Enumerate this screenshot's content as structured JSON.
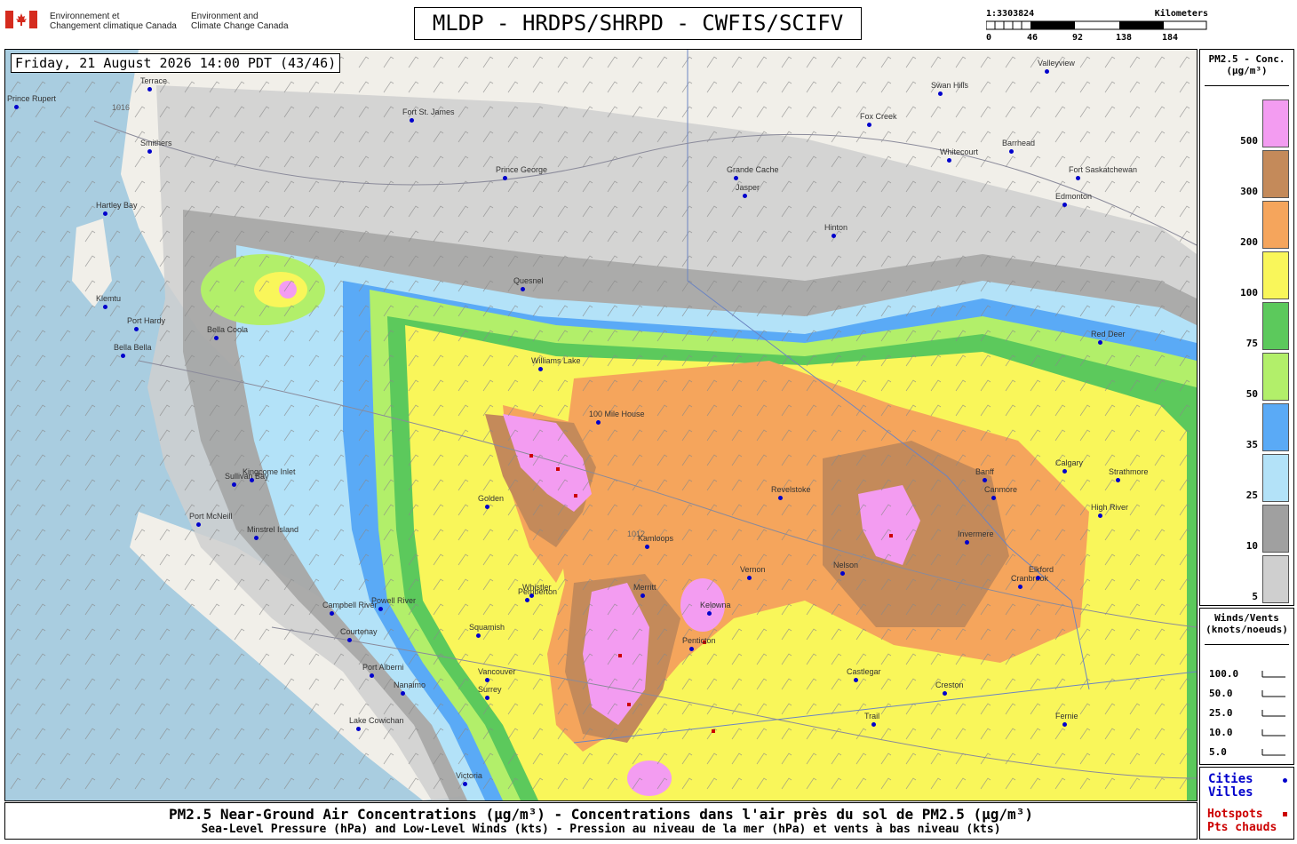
{
  "agency": {
    "fr_line1": "Environnement et",
    "fr_line2": "Changement climatique Canada",
    "en_line1": "Environment and",
    "en_line2": "Climate Change Canada"
  },
  "title": "MLDP - HRDPS/SHRPD - CWFIS/SCIFV",
  "scale": {
    "ratio": "1:3303824",
    "unit": "Kilometers",
    "ticks": [
      "0",
      "46",
      "92",
      "138",
      "184"
    ]
  },
  "datestamp": "Friday, 21 August 2026 14:00 PDT (43/46)",
  "pm_legend": {
    "title_line1": "PM2.5 - Conc.",
    "title_line2": "(µg/m³)",
    "levels": [
      {
        "label": "500",
        "color": "#f39cf1"
      },
      {
        "label": "300",
        "color": "#c48a5a"
      },
      {
        "label": "200",
        "color": "#f5a55c"
      },
      {
        "label": "100",
        "color": "#f9f65a"
      },
      {
        "label": "75",
        "color": "#5cc95c"
      },
      {
        "label": "50",
        "color": "#b2ef6a"
      },
      {
        "label": "35",
        "color": "#5aaaf6"
      },
      {
        "label": "25",
        "color": "#b3e2f8"
      },
      {
        "label": "10",
        "color": "#a0a0a0"
      },
      {
        "label": "5",
        "color": "#cfcfcf"
      }
    ]
  },
  "wind_legend": {
    "title_line1": "Winds/Vents",
    "title_line2": "(knots/noeuds)",
    "entries": [
      "100.0",
      "50.0",
      "25.0",
      "10.0",
      "5.0"
    ]
  },
  "marks_legend": {
    "cities_en": "Cities",
    "cities_fr": "Villes",
    "hotspots_en": "Hotspots",
    "hotspots_fr": "Pts chauds",
    "city_color": "#0000cc",
    "hotspot_color": "#cc0000"
  },
  "caption": {
    "line1": "PM2.5 Near-Ground Air Concentrations (µg/m³) - Concentrations dans l'air près du sol de PM2.5 (µg/m³)",
    "line2": "Sea-Level Pressure (hPa) and Low-Level Winds (kts) - Pression au niveau de la mer (hPa) et vents à bas niveau (kts)"
  },
  "isobar_labels": [
    "1016",
    "1012"
  ],
  "cities": [
    "Prince Rupert",
    "Terrace",
    "Smithers",
    "Fort St. James",
    "Prince George",
    "Quesnel",
    "Williams Lake",
    "100 Mile House",
    "Kamloops",
    "Vernon",
    "Kelowna",
    "Penticton",
    "Revelstoke",
    "Golden",
    "Calgary",
    "Red Deer",
    "Edmonton",
    "Jasper",
    "Vancouver",
    "Victoria",
    "Nanaimo",
    "Port Alberni",
    "Courtenay",
    "Campbell River",
    "Squamish",
    "Whistler",
    "Bella Coola",
    "Port Hardy",
    "Nelson",
    "Cranbrook",
    "Fernie",
    "Grande Cache",
    "Hinton",
    "Fox Creek",
    "Whitecourt",
    "Swan Hills",
    "Valleyview",
    "Barrhead",
    "Fort Saskatchewan",
    "Surrey",
    "Lake Cowichan",
    "Sullivan Bay",
    "Kingcome Inlet",
    "Minstrel Island",
    "Port McNeill",
    "Powell River",
    "Pemberton",
    "Merritt",
    "Castlegar",
    "Trail",
    "Creston",
    "Invermere",
    "Elkford",
    "Banff",
    "Canmore",
    "Strathmore",
    "High River",
    "Hartley Bay",
    "Klemtu",
    "Bella Bella"
  ]
}
